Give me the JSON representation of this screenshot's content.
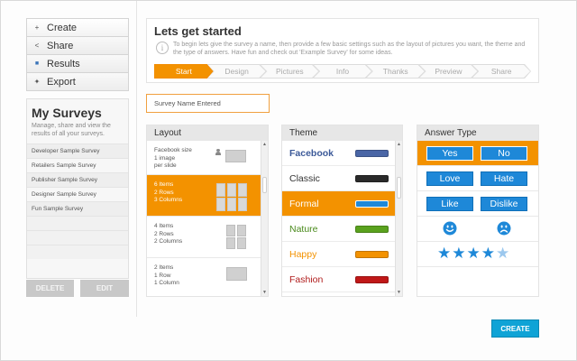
{
  "menu": {
    "items": [
      {
        "icon": "plus-icon",
        "glyph": "+",
        "label": "Create"
      },
      {
        "icon": "share-icon",
        "glyph": "<",
        "label": "Share"
      },
      {
        "icon": "results-icon",
        "glyph": "■",
        "label": "Results"
      },
      {
        "icon": "export-icon",
        "glyph": "✦",
        "label": "Export"
      }
    ]
  },
  "sidebar": {
    "title": "My Surveys",
    "description": "Manage, share and view the results of all your surveys.",
    "surveys": [
      "Developer Sample Survey",
      "Retailers Sample Survey",
      "Publisher Sample Survey",
      "Designer Sample Survey",
      "Fun Sample Survey"
    ],
    "delete_label": "DELETE",
    "edit_label": "EDIT"
  },
  "header": {
    "title": "Lets get started",
    "description": "To begin lets give the survey a name, then provide a few basic settings such as the layout of pictures you want, the theme and the type of answers. Have fun and check out 'Example Survey' for some ideas.",
    "steps": [
      "Start",
      "Design",
      "Pictures",
      "Info",
      "Thanks",
      "Preview",
      "Share"
    ],
    "active_step": "Start"
  },
  "survey_name": {
    "value": "Survey Name Entered"
  },
  "layout": {
    "heading": "Layout",
    "options": [
      {
        "lines": [
          "Facebook size",
          "1 image",
          "per slide"
        ]
      },
      {
        "lines": [
          "6 Items",
          "2 Rows",
          "3 Columns"
        ]
      },
      {
        "lines": [
          "4 Items",
          "2 Rows",
          "2 Columns"
        ]
      },
      {
        "lines": [
          "2 Items",
          "1 Row",
          "1 Column"
        ]
      }
    ],
    "selected_index": 1
  },
  "theme": {
    "heading": "Theme",
    "options": [
      {
        "name": "Facebook",
        "text_color": "#3b5998",
        "swatch_color": "#4a66a6"
      },
      {
        "name": "Classic",
        "text_color": "#333333",
        "swatch_color": "#2a2a2a"
      },
      {
        "name": "Formal",
        "text_color": "#ffffff",
        "swatch_color": "#1e88d8"
      },
      {
        "name": "Nature",
        "text_color": "#4a8a1c",
        "swatch_color": "#5aa21e"
      },
      {
        "name": "Happy",
        "text_color": "#f39200",
        "swatch_color": "#f39200"
      },
      {
        "name": "Fashion",
        "text_color": "#b01c1c",
        "swatch_color": "#c01818"
      }
    ],
    "selected_index": 2
  },
  "answer_type": {
    "heading": "Answer Type",
    "pairs": [
      {
        "left": "Yes",
        "right": "No"
      },
      {
        "left": "Love",
        "right": "Hate"
      },
      {
        "left": "Like",
        "right": "Dislike"
      }
    ],
    "selected_index": 0,
    "smiley_happy": "happy-face-icon",
    "smiley_sad": "sad-face-icon",
    "rating": 4,
    "rating_max": 5
  },
  "colors": {
    "accent": "#f39200",
    "button_blue": "#1e88d8",
    "create_blue": "#0fa3d6"
  },
  "create_label": "CREATE"
}
